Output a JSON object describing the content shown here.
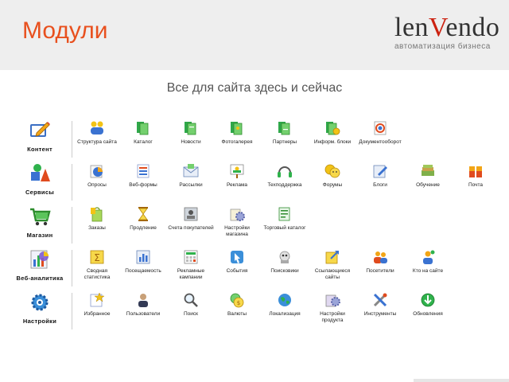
{
  "header": {
    "title": "Модули",
    "logo_text": "lenVendo",
    "logo_tagline": "автоматизация бизнеса"
  },
  "subtitle": "Все для сайта здесь и сейчас",
  "rows": [
    {
      "category": "Контент",
      "icon": "content-edit-icon",
      "items": [
        {
          "label": "Структура сайта",
          "icon": "structure-icon"
        },
        {
          "label": "Каталог",
          "icon": "catalog-icon"
        },
        {
          "label": "Новости",
          "icon": "news-icon"
        },
        {
          "label": "Фотогалерея",
          "icon": "photo-gallery-icon"
        },
        {
          "label": "Партнеры",
          "icon": "partners-icon"
        },
        {
          "label": "Информ. блоки",
          "icon": "info-blocks-icon"
        },
        {
          "label": "Документооборот",
          "icon": "document-flow-icon"
        }
      ]
    },
    {
      "category": "Сервисы",
      "icon": "services-shapes-icon",
      "items": [
        {
          "label": "Опросы",
          "icon": "polls-icon"
        },
        {
          "label": "Веб-формы",
          "icon": "web-forms-icon"
        },
        {
          "label": "Рассылки",
          "icon": "mailing-icon"
        },
        {
          "label": "Реклама",
          "icon": "advertising-icon"
        },
        {
          "label": "Техподдержка",
          "icon": "support-headset-icon"
        },
        {
          "label": "Форумы",
          "icon": "forums-icon"
        },
        {
          "label": "Блоги",
          "icon": "blogs-icon"
        },
        {
          "label": "Обучение",
          "icon": "learning-icon"
        },
        {
          "label": "Почта",
          "icon": "mail-icon"
        }
      ]
    },
    {
      "category": "Магазин",
      "icon": "shop-cart-icon",
      "items": [
        {
          "label": "Заказы",
          "icon": "orders-icon"
        },
        {
          "label": "Продление",
          "icon": "renewal-hourglass-icon"
        },
        {
          "label": "Счета покупателей",
          "icon": "customer-accounts-icon"
        },
        {
          "label": "Настройки магазина",
          "icon": "shop-settings-icon"
        },
        {
          "label": "Торговый каталог",
          "icon": "trade-catalog-icon"
        }
      ]
    },
    {
      "category": "Веб-аналитика",
      "icon": "analytics-chart-icon",
      "items": [
        {
          "label": "Сводная статистика",
          "icon": "summary-stats-icon"
        },
        {
          "label": "Посещаемость",
          "icon": "attendance-icon"
        },
        {
          "label": "Рекламные кампании",
          "icon": "ad-campaigns-icon"
        },
        {
          "label": "События",
          "icon": "events-icon"
        },
        {
          "label": "Поисковики",
          "icon": "search-engines-icon"
        },
        {
          "label": "Ссылающиеся сайты",
          "icon": "referring-sites-icon"
        },
        {
          "label": "Посетители",
          "icon": "visitors-icon"
        },
        {
          "label": "Кто на сайте",
          "icon": "who-online-icon"
        }
      ]
    },
    {
      "category": "Настройки",
      "icon": "settings-gear-icon",
      "items": [
        {
          "label": "Избранное",
          "icon": "favorites-star-icon"
        },
        {
          "label": "Пользователи",
          "icon": "users-icon"
        },
        {
          "label": "Поиск",
          "icon": "search-icon"
        },
        {
          "label": "Валюты",
          "icon": "currencies-icon"
        },
        {
          "label": "Локализация",
          "icon": "localization-globe-icon"
        },
        {
          "label": "Настройки продукта",
          "icon": "product-settings-icon"
        },
        {
          "label": "Инструменты",
          "icon": "tools-icon"
        },
        {
          "label": "Обновления",
          "icon": "updates-icon"
        }
      ]
    }
  ],
  "colors": {
    "title": "#e8501e",
    "logo_accent": "#cc2211",
    "topbar": "#eeeeee"
  }
}
